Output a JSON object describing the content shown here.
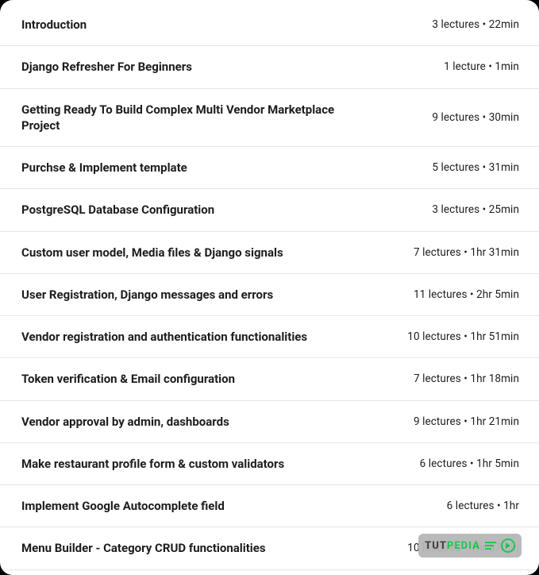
{
  "watermark": {
    "part1": "TUT",
    "part2": "PEDIA"
  },
  "sections": [
    {
      "title": "Introduction",
      "meta": "3 lectures • 22min"
    },
    {
      "title": "Django Refresher For Beginners",
      "meta": "1 lecture • 1min"
    },
    {
      "title": "Getting Ready To Build Complex Multi Vendor Marketplace Project",
      "meta": "9 lectures • 30min"
    },
    {
      "title": "Purchse & Implement template",
      "meta": "5 lectures • 31min"
    },
    {
      "title": "PostgreSQL Database Configuration",
      "meta": "3 lectures • 25min"
    },
    {
      "title": "Custom user model, Media files & Django signals",
      "meta": "7 lectures • 1hr 31min"
    },
    {
      "title": "User Registration, Django messages and errors",
      "meta": "11 lectures • 2hr 5min"
    },
    {
      "title": "Vendor registration and authentication functionalities",
      "meta": "10 lectures • 1hr 51min"
    },
    {
      "title": "Token verification & Email configuration",
      "meta": "7 lectures • 1hr 18min"
    },
    {
      "title": "Vendor approval by admin, dashboards",
      "meta": "9 lectures • 1hr 21min"
    },
    {
      "title": "Make restaurant profile form & custom validators",
      "meta": "6 lectures • 1hr 5min"
    },
    {
      "title": "Implement Google Autocomplete field",
      "meta": "6 lectures • 1hr"
    },
    {
      "title": "Menu Builder - Category CRUD functionalities",
      "meta": "10 lectures • 1hr 57min"
    }
  ]
}
